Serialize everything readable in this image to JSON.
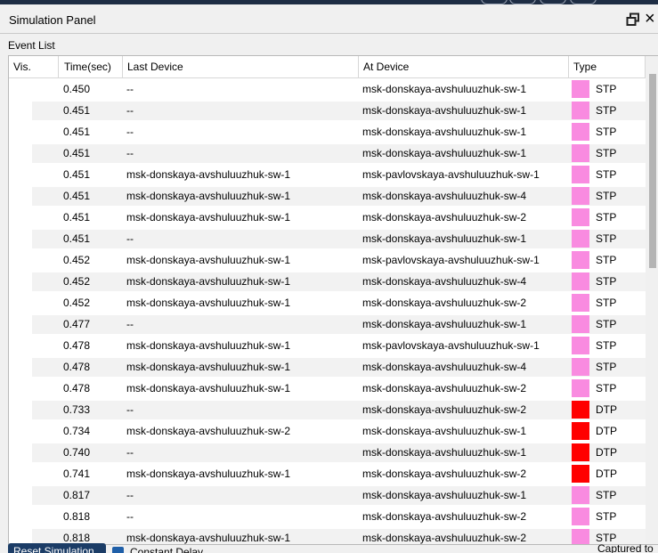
{
  "panel": {
    "title": "Simulation Panel",
    "event_list_label": "Event List"
  },
  "columns": {
    "vis": "Vis.",
    "time": "Time(sec)",
    "last": "Last Device",
    "at": "At Device",
    "type": "Type"
  },
  "type_colors": {
    "STP": "#f98be0",
    "DTP": "#ff0000"
  },
  "rows": [
    {
      "time": "0.450",
      "last": "--",
      "at": "msk-donskaya-avshuluuzhuk-sw-1",
      "type": "STP"
    },
    {
      "time": "0.451",
      "last": "--",
      "at": "msk-donskaya-avshuluuzhuk-sw-1",
      "type": "STP"
    },
    {
      "time": "0.451",
      "last": "--",
      "at": "msk-donskaya-avshuluuzhuk-sw-1",
      "type": "STP"
    },
    {
      "time": "0.451",
      "last": "--",
      "at": "msk-donskaya-avshuluuzhuk-sw-1",
      "type": "STP"
    },
    {
      "time": "0.451",
      "last": "msk-donskaya-avshuluuzhuk-sw-1",
      "at": "msk-pavlovskaya-avshuluuzhuk-sw-1",
      "type": "STP"
    },
    {
      "time": "0.451",
      "last": "msk-donskaya-avshuluuzhuk-sw-1",
      "at": "msk-donskaya-avshuluuzhuk-sw-4",
      "type": "STP"
    },
    {
      "time": "0.451",
      "last": "msk-donskaya-avshuluuzhuk-sw-1",
      "at": "msk-donskaya-avshuluuzhuk-sw-2",
      "type": "STP"
    },
    {
      "time": "0.451",
      "last": "--",
      "at": "msk-donskaya-avshuluuzhuk-sw-1",
      "type": "STP"
    },
    {
      "time": "0.452",
      "last": "msk-donskaya-avshuluuzhuk-sw-1",
      "at": "msk-pavlovskaya-avshuluuzhuk-sw-1",
      "type": "STP"
    },
    {
      "time": "0.452",
      "last": "msk-donskaya-avshuluuzhuk-sw-1",
      "at": "msk-donskaya-avshuluuzhuk-sw-4",
      "type": "STP"
    },
    {
      "time": "0.452",
      "last": "msk-donskaya-avshuluuzhuk-sw-1",
      "at": "msk-donskaya-avshuluuzhuk-sw-2",
      "type": "STP"
    },
    {
      "time": "0.477",
      "last": "--",
      "at": "msk-donskaya-avshuluuzhuk-sw-1",
      "type": "STP"
    },
    {
      "time": "0.478",
      "last": "msk-donskaya-avshuluuzhuk-sw-1",
      "at": "msk-pavlovskaya-avshuluuzhuk-sw-1",
      "type": "STP"
    },
    {
      "time": "0.478",
      "last": "msk-donskaya-avshuluuzhuk-sw-1",
      "at": "msk-donskaya-avshuluuzhuk-sw-4",
      "type": "STP"
    },
    {
      "time": "0.478",
      "last": "msk-donskaya-avshuluuzhuk-sw-1",
      "at": "msk-donskaya-avshuluuzhuk-sw-2",
      "type": "STP"
    },
    {
      "time": "0.733",
      "last": "--",
      "at": "msk-donskaya-avshuluuzhuk-sw-2",
      "type": "DTP"
    },
    {
      "time": "0.734",
      "last": "msk-donskaya-avshuluuzhuk-sw-2",
      "at": "msk-donskaya-avshuluuzhuk-sw-1",
      "type": "DTP"
    },
    {
      "time": "0.740",
      "last": "--",
      "at": "msk-donskaya-avshuluuzhuk-sw-1",
      "type": "DTP"
    },
    {
      "time": "0.741",
      "last": "msk-donskaya-avshuluuzhuk-sw-1",
      "at": "msk-donskaya-avshuluuzhuk-sw-2",
      "type": "DTP"
    },
    {
      "time": "0.817",
      "last": "--",
      "at": "msk-donskaya-avshuluuzhuk-sw-1",
      "type": "STP"
    },
    {
      "time": "0.818",
      "last": "--",
      "at": "msk-donskaya-avshuluuzhuk-sw-2",
      "type": "STP"
    },
    {
      "time": "0.818",
      "last": "msk-donskaya-avshuluuzhuk-sw-1",
      "at": "msk-donskaya-avshuluuzhuk-sw-2",
      "type": "STP"
    }
  ],
  "bottom": {
    "reset_label": "Reset Simulation",
    "constant_label": "Constant Delay",
    "captured_label": "Captured to"
  }
}
